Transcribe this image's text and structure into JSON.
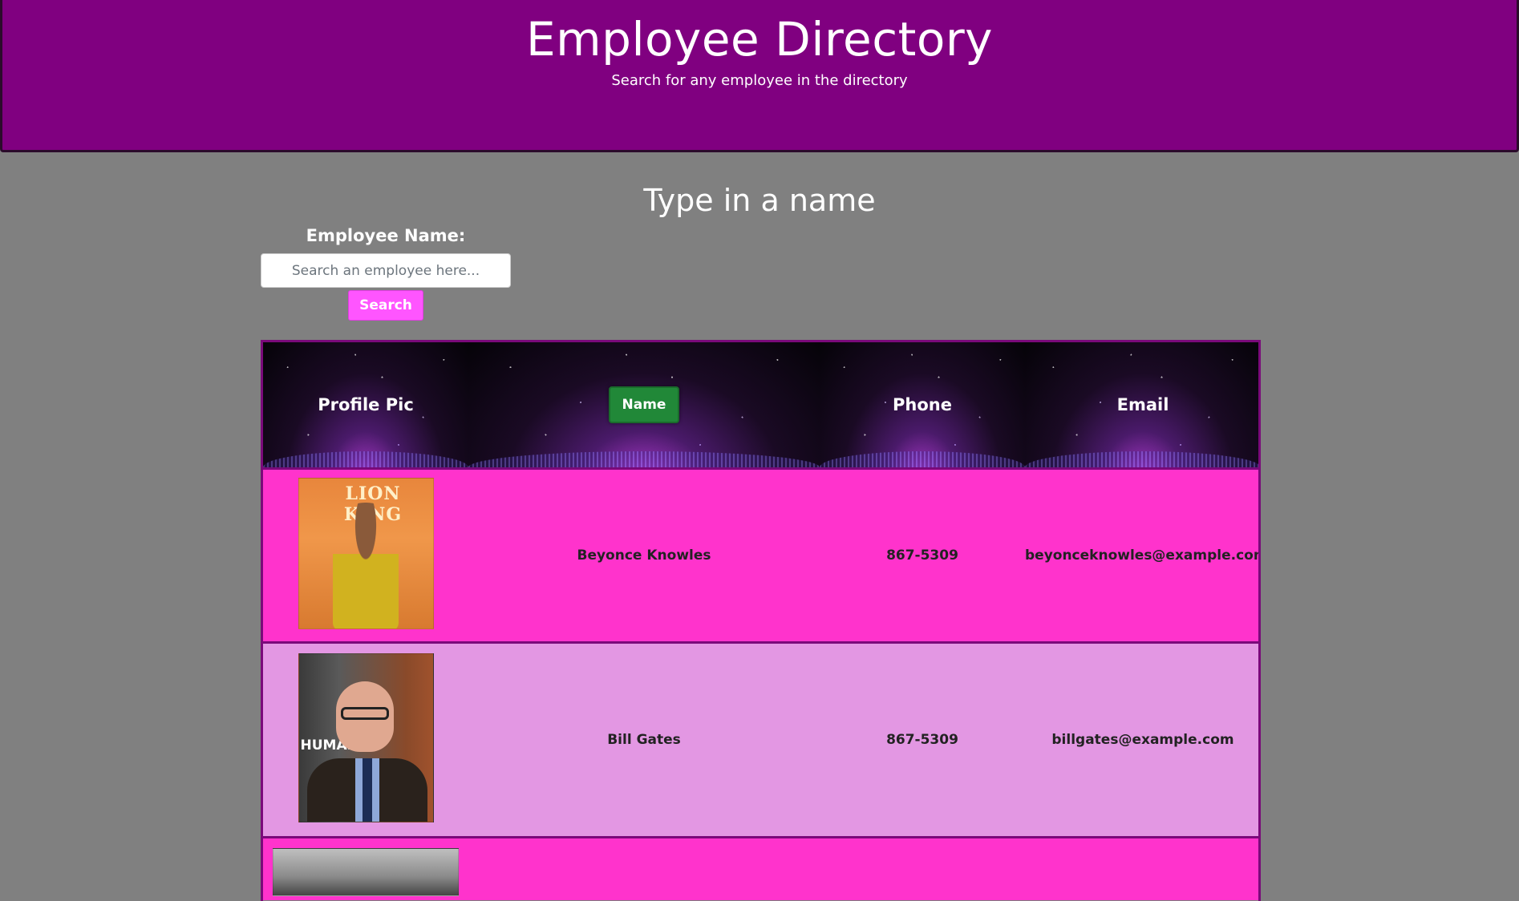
{
  "header": {
    "title": "Employee Directory",
    "subtitle": "Search for any employee in the directory"
  },
  "search": {
    "heading": "Type in a name",
    "label": "Employee Name:",
    "placeholder": "Search an employee here...",
    "button_label": "Search"
  },
  "table": {
    "columns": {
      "profile_pic": "Profile Pic",
      "name": "Name",
      "phone": "Phone",
      "email": "Email"
    },
    "rows": [
      {
        "name": "Beyonce Knowles",
        "phone": "867-5309",
        "email": "beyonceknowles@example.com",
        "photo_text": "LION KING"
      },
      {
        "name": "Bill Gates",
        "phone": "867-5309",
        "email": "billgates@example.com",
        "photo_text": "HUMAN ES"
      },
      {
        "name": "",
        "phone": "",
        "email": ""
      }
    ]
  },
  "colors": {
    "header_bg": "#800080",
    "page_bg": "#808080",
    "search_button": "#ff55ff",
    "sort_button": "#218838",
    "row_odd": "#ff33cc",
    "row_even": "#e397e3",
    "table_border": "#7a0a7a"
  }
}
